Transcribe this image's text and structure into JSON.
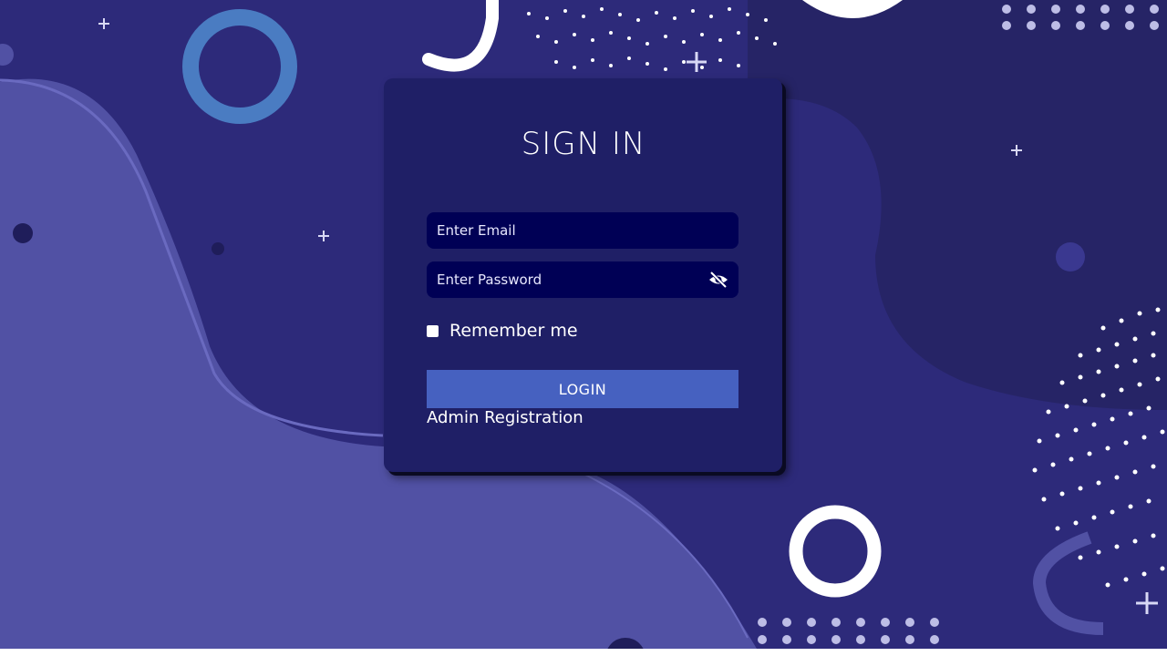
{
  "login_form": {
    "title": "SIGN IN",
    "email_placeholder": "Enter Email",
    "password_placeholder": "Enter Password",
    "remember_label": "Remember me",
    "login_label": "LOGIN",
    "admin_link": "Admin Registration"
  },
  "icons": {
    "password_toggle": "eye-slash-icon",
    "remember_checkbox": "checkbox-unchecked"
  },
  "colors": {
    "background": "#2d2a7a",
    "blob_light": "#5151a4",
    "card": "#1f1f66",
    "input": "#000055",
    "login_button": "#4661c0",
    "text": "#ffffff",
    "ring_blue": "#4a7cc2"
  }
}
